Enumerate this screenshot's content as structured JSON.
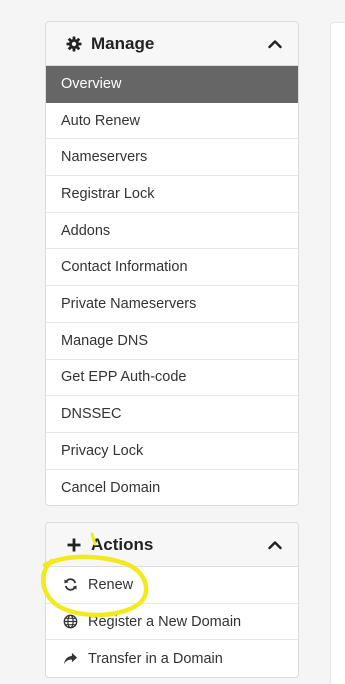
{
  "manage": {
    "title": "Manage",
    "icon": "gear-icon",
    "items": [
      {
        "label": "Overview",
        "active": true
      },
      {
        "label": "Auto Renew"
      },
      {
        "label": "Nameservers"
      },
      {
        "label": "Registrar Lock"
      },
      {
        "label": "Addons"
      },
      {
        "label": "Contact Information"
      },
      {
        "label": "Private Nameservers"
      },
      {
        "label": "Manage DNS"
      },
      {
        "label": "Get EPP Auth-code"
      },
      {
        "label": "DNSSEC"
      },
      {
        "label": "Privacy Lock"
      },
      {
        "label": "Cancel Domain"
      }
    ]
  },
  "actions": {
    "title": "Actions",
    "icon": "plus-icon",
    "items": [
      {
        "label": "Renew",
        "icon": "refresh-icon"
      },
      {
        "label": "Register a New Domain",
        "icon": "globe-icon"
      },
      {
        "label": "Transfer in a Domain",
        "icon": "share-arrow-icon"
      }
    ]
  },
  "colors": {
    "active_bg": "#666666",
    "highlight": "#f2ea1d"
  }
}
